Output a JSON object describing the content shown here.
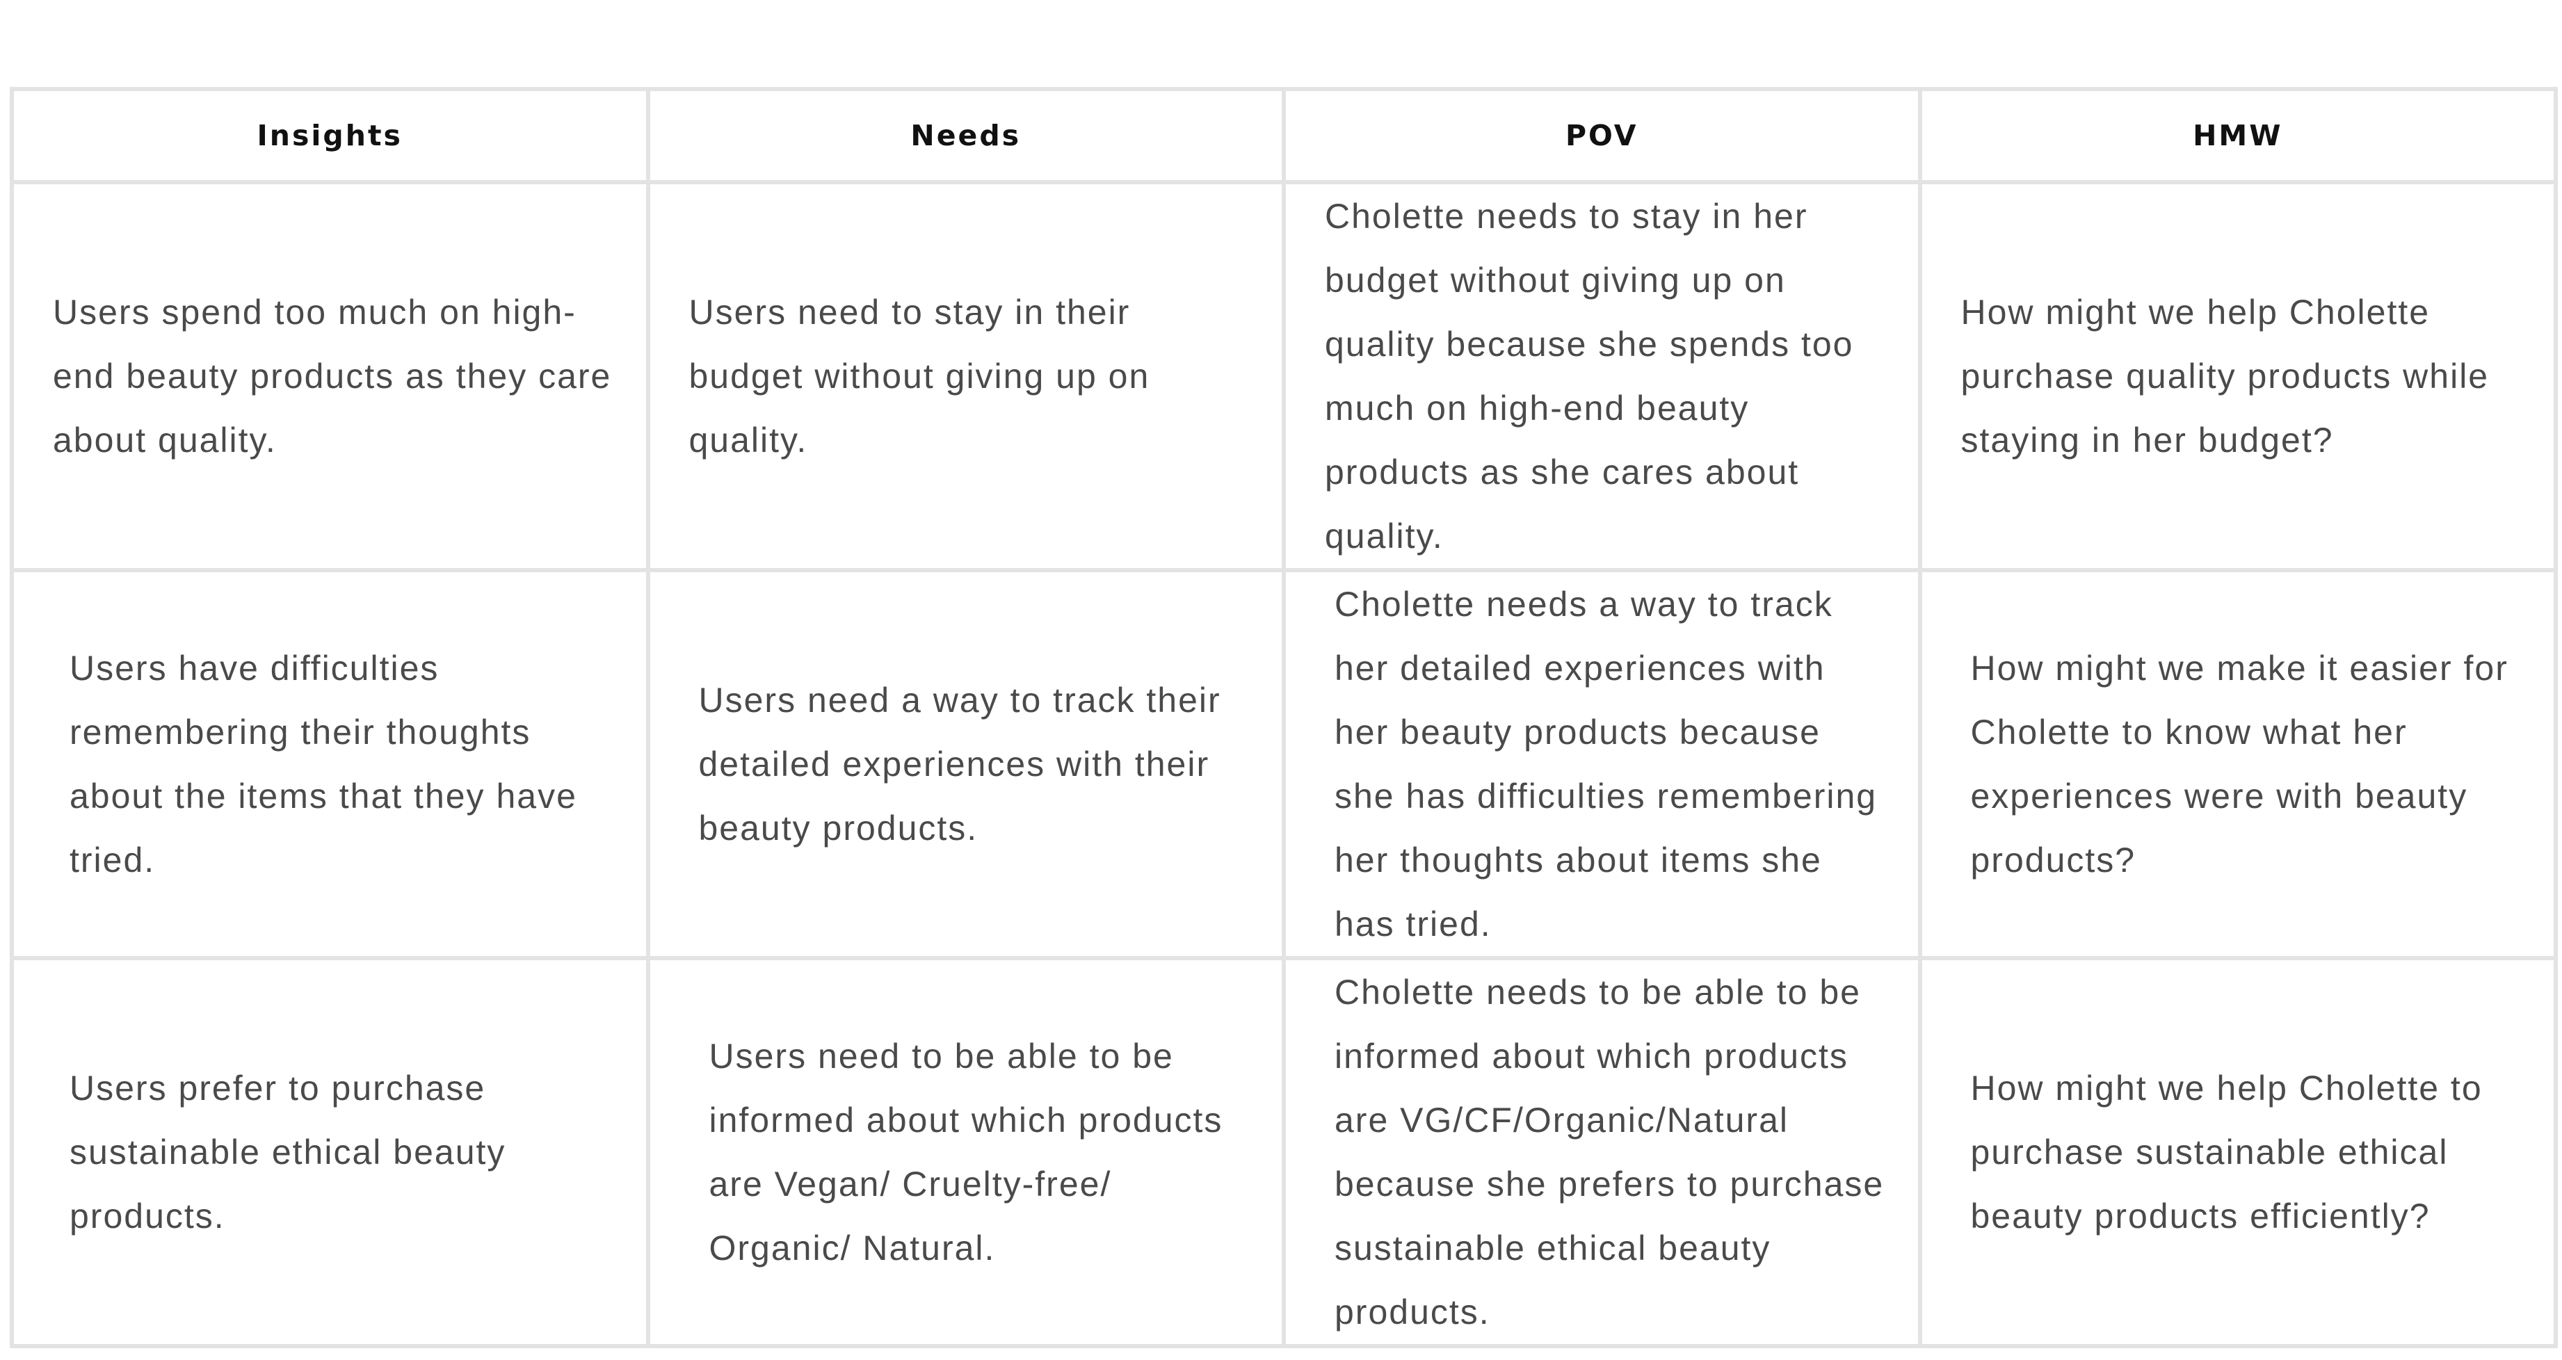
{
  "table": {
    "headers": [
      "Insights",
      "Needs",
      "POV",
      "HMW"
    ],
    "rows": [
      [
        "Users spend too much on high-end beauty products as they care about quality.",
        "Users need to stay in their budget without giving up on quality.",
        "Cholette needs to stay in her budget without giving up on quality because she spends too much on high-end beauty products as she cares about quality.",
        "How might we help Cholette purchase quality products while staying in her budget?"
      ],
      [
        "Users have difficulties remembering their thoughts about the items that they have tried.",
        "Users need a way to track their detailed experiences with their beauty products.",
        "Cholette needs a way to track her detailed experiences with her beauty products because she has difficulties remembering her thoughts about items she has tried.",
        "How might we make it easier for Cholette to know what her experiences were with beauty products?"
      ],
      [
        "Users prefer to purchase sustainable ethical beauty products.",
        "Users need to be able to be informed about which products are Vegan/ Cruelty-free/ Organic/ Natural.",
        "Cholette needs to be able to be informed about which products are VG/CF/Organic/Natural because she prefers to purchase sustainable ethical beauty products.",
        "How might we help Cholette to purchase sustainable ethical beauty products efficiently?"
      ]
    ]
  }
}
